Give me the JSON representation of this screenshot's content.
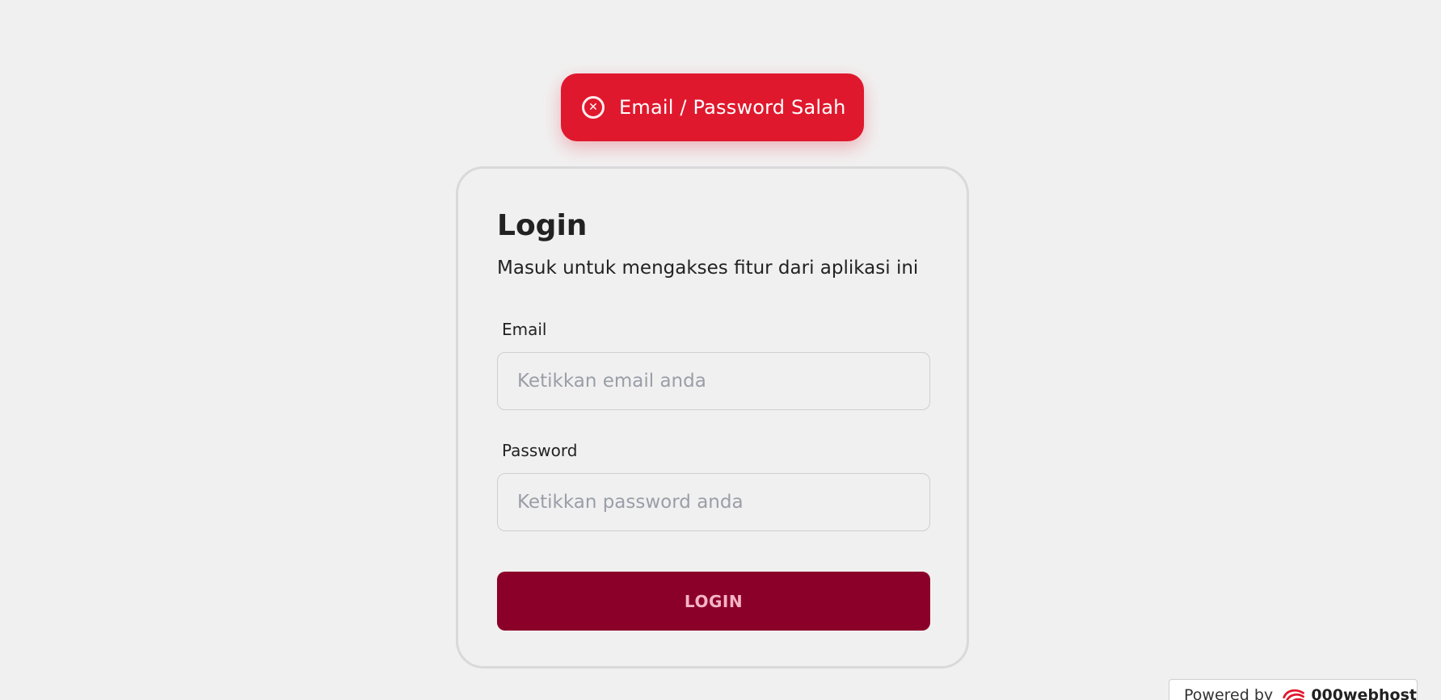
{
  "toast": {
    "message": "Email / Password Salah",
    "icon": "close-circle-icon",
    "color": "#e0182d"
  },
  "login": {
    "title": "Login",
    "subtitle": "Masuk untuk mengakses fitur dari aplikasi ini",
    "email_label": "Email",
    "email_placeholder": "Ketikkan email anda",
    "password_label": "Password",
    "password_placeholder": "Ketikkan password anda",
    "button_label": "LOGIN",
    "button_color": "#8b0029"
  },
  "badge": {
    "prefix": "Powered by",
    "brand": "000webhost",
    "icon": "000webhost-logo-icon"
  }
}
